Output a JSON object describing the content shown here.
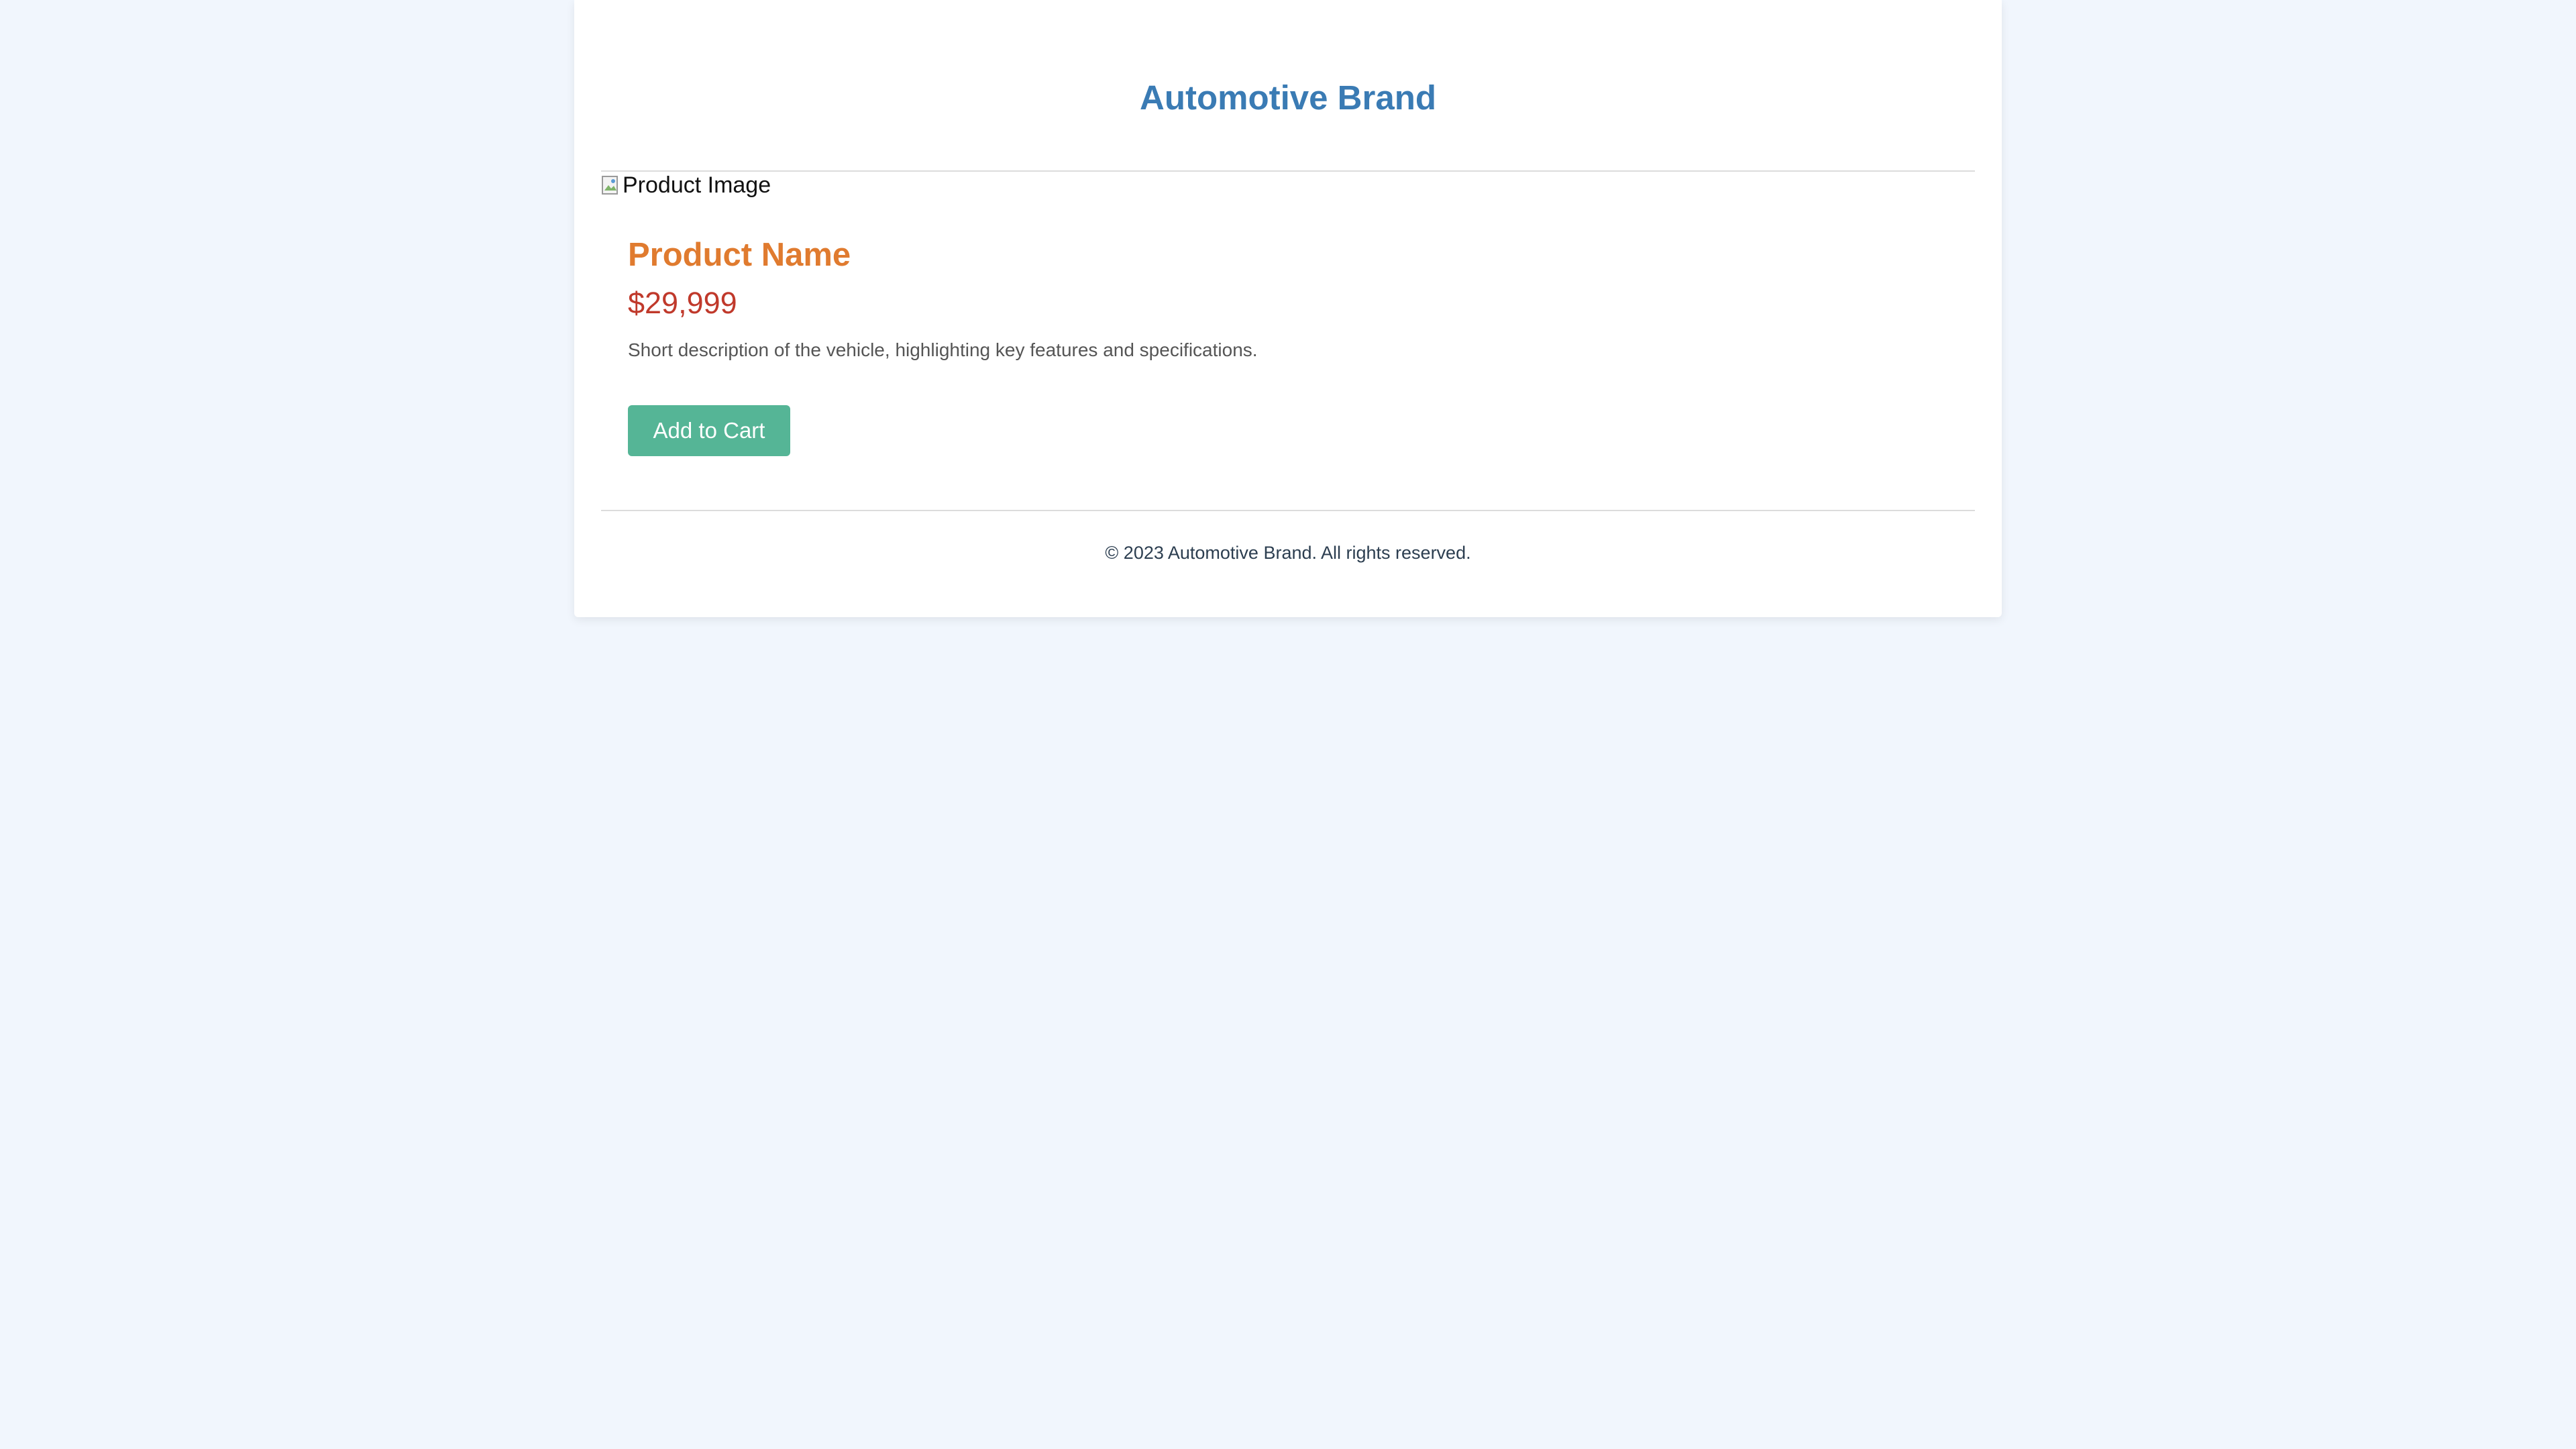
{
  "header": {
    "brand_title": "Automotive Brand"
  },
  "product": {
    "image_alt": "Product Image",
    "image_icon": "broken-image-icon",
    "name": "Product Name",
    "price": "$29,999",
    "description": "Short description of the vehicle, highlighting key features and specifications.",
    "add_to_cart_label": "Add to Cart"
  },
  "footer": {
    "copyright": "© 2023 Automotive Brand. All rights reserved."
  },
  "colors": {
    "page_background": "#f1f6fd",
    "brand_blue": "#3a7bb4",
    "product_name_orange": "#e07b2f",
    "price_red": "#c0392b",
    "button_green": "#55b596",
    "footer_text": "#2c3e50"
  }
}
